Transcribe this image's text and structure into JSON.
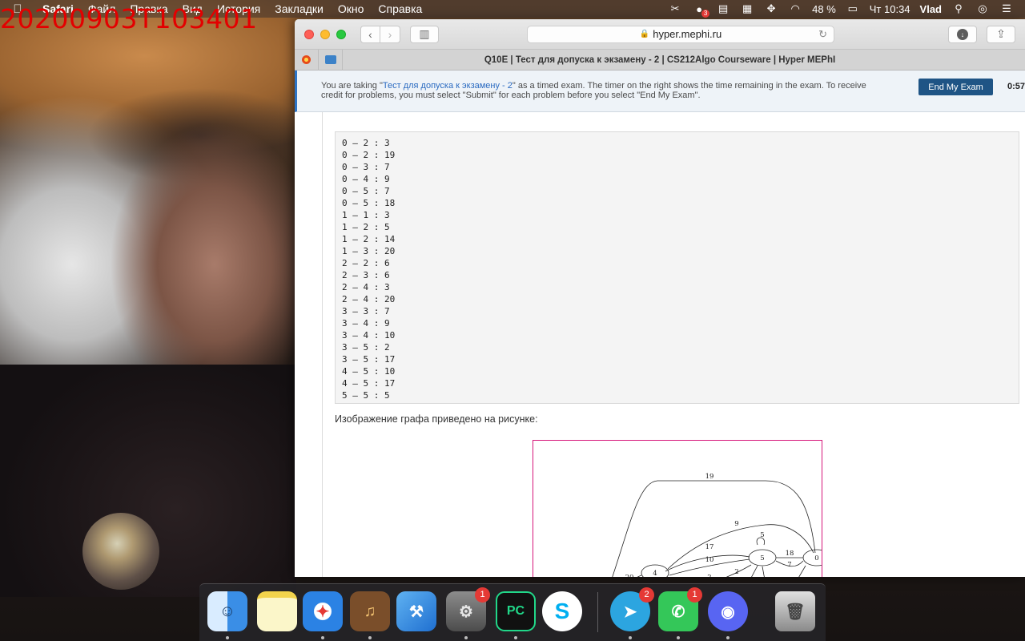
{
  "overlay": {
    "timestamp": "20200903T103401"
  },
  "menubar": {
    "items": [
      "Safari",
      "Файл",
      "Правка",
      "Вид",
      "История",
      "Закладки",
      "Окно",
      "Справка"
    ],
    "battery": "48 %",
    "clock": "Чт 10:34",
    "user": "Vlad",
    "notification_badge": "3"
  },
  "browser": {
    "url": "hyper.mephi.ru",
    "tab_title": "Q10E | Тест для допуска к экзамену - 2 | CS212Algo Courseware | Hyper MEPhI"
  },
  "exam_banner": {
    "text_before": "You are taking \"",
    "exam_link": "Тест для допуска к экзамену - 2",
    "text_after": "\" as a timed exam. The timer on the right shows the time remaining in the exam. To receive credit for problems, you must select \"Submit\" for each problem before you select \"End My Exam\".",
    "end_button": "End My Exam",
    "timer": "0:57:"
  },
  "problem": {
    "edges": [
      "0 — 2 : 3",
      "0 — 2 : 19",
      "0 — 3 : 7",
      "0 — 4 : 9",
      "0 — 5 : 7",
      "0 — 5 : 18",
      "1 — 1 : 3",
      "1 — 2 : 5",
      "1 — 2 : 14",
      "1 — 3 : 20",
      "2 — 2 : 6",
      "2 — 3 : 6",
      "2 — 4 : 3",
      "2 — 4 : 20",
      "3 — 3 : 7",
      "3 — 4 : 9",
      "3 — 4 : 10",
      "3 — 5 : 2",
      "3 — 5 : 17",
      "4 — 5 : 10",
      "4 — 5 : 17",
      "5 — 5 : 5"
    ],
    "caption": "Изображение графа приведено на рисунке:",
    "graph": {
      "nodes": [
        "4",
        "5",
        "0"
      ],
      "labels": [
        "19",
        "9",
        "5",
        "17",
        "10",
        "18",
        "7",
        "2",
        "20",
        "2"
      ]
    }
  },
  "dock": {
    "apps": [
      {
        "name": "Finder",
        "glyph": "☺",
        "badge": ""
      },
      {
        "name": "Notes",
        "glyph": "",
        "badge": ""
      },
      {
        "name": "Safari",
        "glyph": "✦",
        "badge": ""
      },
      {
        "name": "GarageBand",
        "glyph": "♫",
        "badge": ""
      },
      {
        "name": "Xcode",
        "glyph": "⚒",
        "badge": ""
      },
      {
        "name": "System Preferences",
        "glyph": "⚙",
        "badge": "1"
      },
      {
        "name": "PyCharm",
        "glyph": "PC",
        "badge": ""
      },
      {
        "name": "Skype",
        "glyph": "S",
        "badge": ""
      },
      {
        "name": "Telegram",
        "glyph": "➤",
        "badge": "2"
      },
      {
        "name": "FaceTime",
        "glyph": "✆",
        "badge": "1"
      },
      {
        "name": "Discord",
        "glyph": "◉",
        "badge": ""
      },
      {
        "name": "Trash",
        "glyph": "🗑",
        "badge": ""
      }
    ]
  }
}
